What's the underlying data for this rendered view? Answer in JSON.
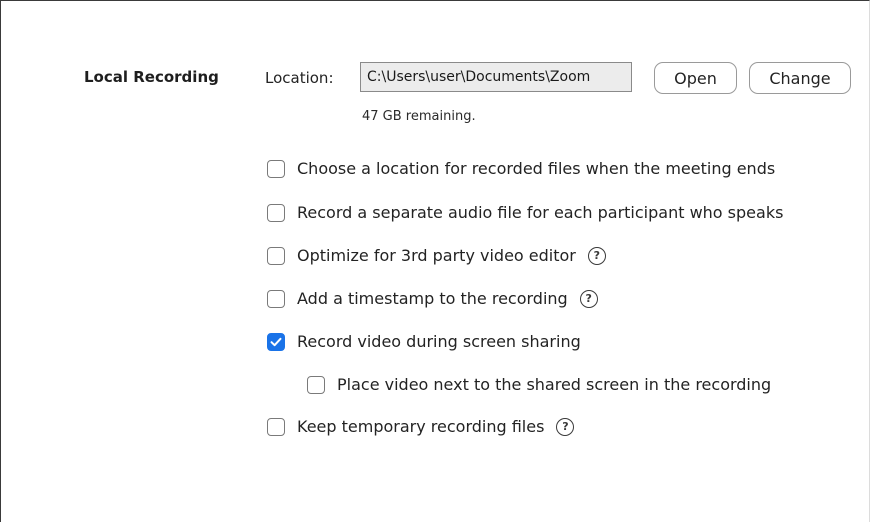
{
  "section": {
    "title": "Local Recording"
  },
  "location": {
    "label": "Location:",
    "path": "C:\\Users\\user\\Documents\\Zoom",
    "open_label": "Open",
    "change_label": "Change",
    "remaining": "47 GB remaining."
  },
  "options": [
    {
      "label": "Choose a location for recorded files when the meeting ends",
      "checked": false,
      "help": false
    },
    {
      "label": "Record a separate audio file for each participant who speaks",
      "checked": false,
      "help": false
    },
    {
      "label": "Optimize for 3rd party video editor",
      "checked": false,
      "help": true
    },
    {
      "label": "Add a timestamp to the recording",
      "checked": false,
      "help": true
    },
    {
      "label": "Record video during screen sharing",
      "checked": true,
      "help": false
    },
    {
      "label": "Place video next to the shared screen in the recording",
      "checked": false,
      "help": false
    },
    {
      "label": "Keep temporary recording files",
      "checked": false,
      "help": true
    }
  ],
  "help_glyph": "?",
  "colors": {
    "checked_blue": "#1a73e8"
  }
}
